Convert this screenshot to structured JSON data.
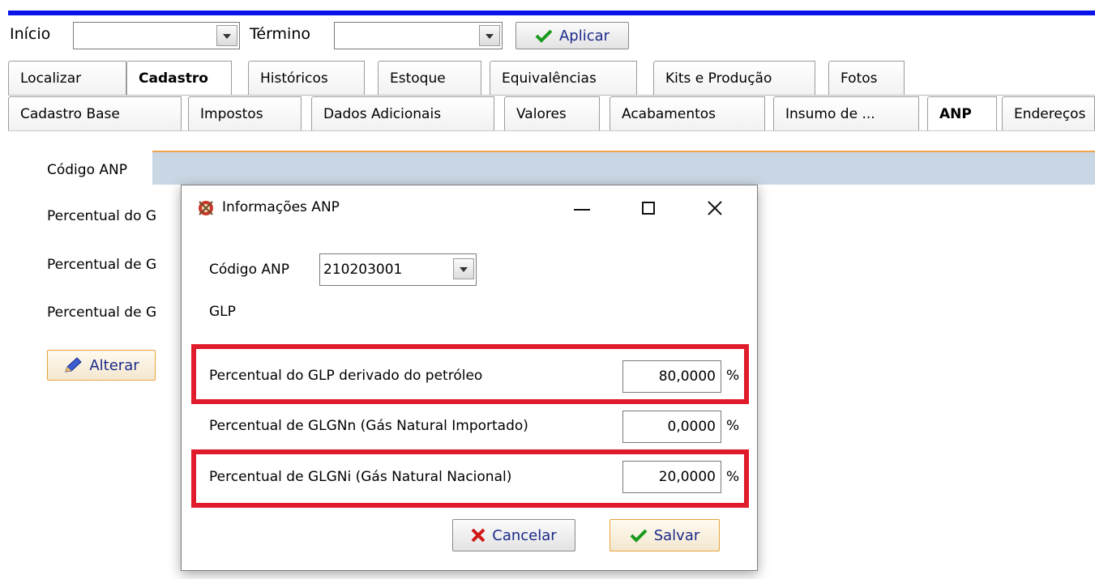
{
  "toolbar": {
    "inicio_label": "Início",
    "termino_label": "Término",
    "aplicar_label": "Aplicar"
  },
  "main_tabs": [
    {
      "label": "Localizar"
    },
    {
      "label": "Cadastro"
    },
    {
      "label": "Históricos"
    },
    {
      "label": "Estoque"
    },
    {
      "label": "Equivalências"
    },
    {
      "label": "Kits e Produção"
    },
    {
      "label": "Fotos"
    }
  ],
  "sub_tabs": [
    {
      "label": "Cadastro Base"
    },
    {
      "label": "Impostos"
    },
    {
      "label": "Dados Adicionais"
    },
    {
      "label": "Valores"
    },
    {
      "label": "Acabamentos"
    },
    {
      "label": "Insumo de ..."
    },
    {
      "label": "ANP"
    },
    {
      "label": "Endereços"
    }
  ],
  "anp_panel": {
    "codigo_label": "Código ANP",
    "perc_glp_label": "Percentual do G",
    "perc_glgnn_label": "Percentual de G",
    "perc_glgni_label": "Percentual de G",
    "alterar_label": "Alterar"
  },
  "dialog": {
    "title": "Informações ANP",
    "codigo_label": "Código ANP",
    "codigo_value": "210203001",
    "product_name": "GLP",
    "rows": [
      {
        "label": "Percentual do GLP derivado do petróleo",
        "value": "80,0000",
        "unit": "%"
      },
      {
        "label": "Percentual de GLGNn (Gás Natural Importado)",
        "value": "0,0000",
        "unit": "%"
      },
      {
        "label": "Percentual de GLGNi (Gás Natural Nacional)",
        "value": "20,0000",
        "unit": "%"
      }
    ],
    "cancelar_label": "Cancelar",
    "salvar_label": "Salvar"
  },
  "colors": {
    "highlight": "#e01b2b",
    "top_bar": "#0a14e8",
    "button_text": "#1b2a8a"
  }
}
